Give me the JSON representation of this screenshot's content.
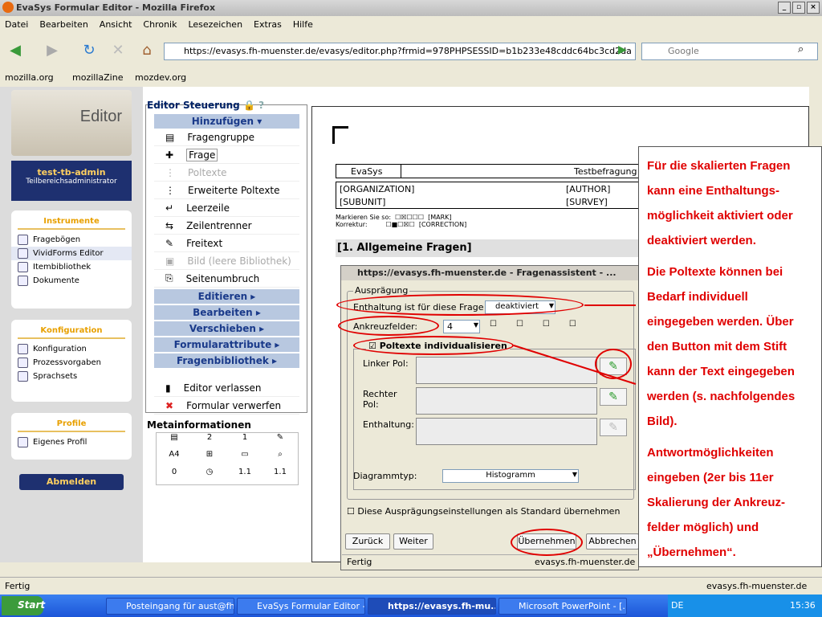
{
  "window": {
    "title": "EvaSys Formular Editor - Mozilla Firefox"
  },
  "menubar": [
    "Datei",
    "Bearbeiten",
    "Ansicht",
    "Chronik",
    "Lesezeichen",
    "Extras",
    "Hilfe"
  ],
  "url": "https://evasys.fh-muenster.de/evasys/editor.php?frmid=978PHPSESSID=b1b233e48cddc64bc3cd2da",
  "search_placeholder": "Google",
  "bookmarks": [
    "mozilla.org",
    "mozillaZine",
    "mozdev.org"
  ],
  "logo": "Editor",
  "user": {
    "name": "test-tb-admin",
    "role": "Teilbereichsadministrator"
  },
  "instrumente": {
    "title": "Instrumente",
    "items": [
      "Fragebögen",
      "VividForms Editor",
      "Itembibliothek",
      "Dokumente"
    ]
  },
  "konfiguration": {
    "title": "Konfiguration",
    "items": [
      "Konfiguration",
      "Prozessvorgaben",
      "Sprachsets"
    ]
  },
  "profile": {
    "title": "Profile",
    "items": [
      "Eigenes Profil"
    ]
  },
  "logout": "Abmelden",
  "steuerung": {
    "title": "Editor Steuerung",
    "help": "?"
  },
  "hinzufuegen": "Hinzufügen ▾",
  "add_items": [
    "Fragengruppe",
    "Frage",
    "Poltexte",
    "Erweiterte Poltexte",
    "Leerzeile",
    "Zeilentrenner",
    "Freitext",
    "Bild (leere Bibliothek)",
    "Seitenumbruch"
  ],
  "menus": [
    "Editieren ▸",
    "Bearbeiten ▸",
    "Verschieben ▸",
    "Formularattribute ▸",
    "Fragenbibliothek ▸"
  ],
  "actions": [
    "Editor verlassen",
    "Formular verwerfen"
  ],
  "meta": {
    "title": "Metainformationen",
    "cells": [
      "2",
      "1",
      "A4",
      "0",
      "1.1",
      "1.1"
    ]
  },
  "form": {
    "evasys": "EvaSys",
    "testbefragung": "Testbefragung",
    "org": "[ORGANIZATION]",
    "author": "[AUTHOR]",
    "subunit": "[SUBUNIT]",
    "survey": "[SURVEY]",
    "markieren": "Markieren Sie so:",
    "mark": "[MARK]",
    "korrektur": "Korrektur:",
    "correction": "[CORRECTION]",
    "section": "[1. Allgemeine Fragen]"
  },
  "dialog": {
    "title": "https://evasys.fh-muenster.de - Fragenassistent - ...",
    "group": "Ausprägung",
    "enthaltung_label": "Enthaltung ist für diese Frage",
    "enthaltung_value": "deaktiviert",
    "ankreuz_label": "Ankreuzfelder:",
    "ankreuz_value": "4",
    "poltexte_label": "Poltexte individualisieren",
    "linker": "Linker Pol:",
    "rechter": "Rechter Pol:",
    "enthaltung": "Enthaltung:",
    "diagramm_label": "Diagrammtyp:",
    "diagramm_value": "Histogramm",
    "standard": "Diese Ausprägungseinstellungen als Standard übernehmen",
    "zurueck": "Zurück",
    "weiter": "Weiter",
    "uebernehmen": "Übernehmen",
    "abbrechen": "Abbrechen",
    "status": "Fertig",
    "status_host": "evasys.fh-muenster.de"
  },
  "notes": [
    "Für die skalierten Fragen kann eine Enthaltungs-möglichkeit aktiviert oder deaktiviert werden.",
    "Die Poltexte können bei Bedarf individuell eingegeben werden. Über den Button mit dem Stift kann der Text eingegeben werden (s. nachfolgendes Bild).",
    "Antwortmöglichkeiten eingeben (2er bis 11er Skalierung der Ankreuz-felder möglich) und „Übernehmen“."
  ],
  "statusbar": {
    "left": "Fertig",
    "right": "evasys.fh-muenster.de"
  },
  "taskbar": {
    "start": "Start",
    "tasks": [
      "Posteingang für aust@fh...",
      "EvaSys Formular Editor -...",
      "https://evasys.fh-mu...",
      "Microsoft PowerPoint - [..."
    ],
    "lang": "DE",
    "time": "15:36"
  }
}
